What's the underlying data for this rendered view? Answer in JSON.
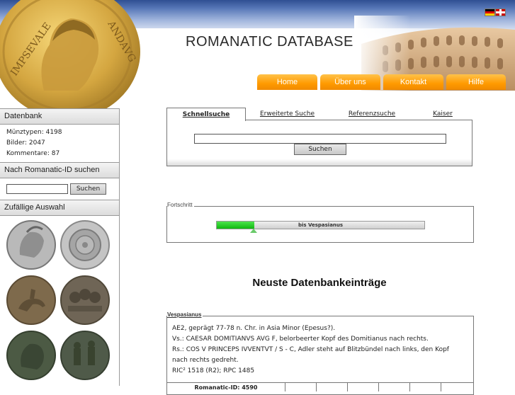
{
  "header": {
    "title": "ROMANATIC DATABASE",
    "nav": [
      "Home",
      "Über uns",
      "Kontakt",
      "Hilfe"
    ],
    "languages": [
      "Deutsch",
      "English"
    ]
  },
  "sidebar": {
    "datenbank": {
      "heading": "Datenbank",
      "stats": [
        "Münztypen: 4198",
        "Bilder: 2047",
        "Kommentare: 87"
      ]
    },
    "id_search": {
      "heading": "Nach Romanatic-ID suchen",
      "button": "Suchen"
    },
    "random": {
      "heading": "Zufällige Auswahl"
    }
  },
  "search": {
    "tabs": [
      "Schnellsuche",
      "Erweiterte Suche",
      "Referenzsuche",
      "Kaiser"
    ],
    "button": "Suchen"
  },
  "progress": {
    "legend": "Fortschritt",
    "label": "bis Vespasianus",
    "fraction": 0.18
  },
  "newest": {
    "title": "Neuste Datenbankeinträge",
    "entry": {
      "legend": "Vespasianus",
      "lines": [
        "AE2, geprägt 77-78 n. Chr. in Asia Minor (Epesus?).",
        "Vs.: CAESAR DOMITIANVS AVG F, belorbeerter Kopf des Domitianus nach rechts.",
        "Rs.: COS V PRINCEPS IVVENTVT / S - C, Adler steht auf Blitzbündel nach links, den Kopf nach rechts gedreht.",
        "RIC² 1518 (R2); RPC 1485"
      ],
      "footer_id": "Romanatic-ID: 4590"
    }
  },
  "colors": {
    "nav_orange": "#ff9a00",
    "progress_green": "#10b810",
    "sky_blue": "#2f4f92"
  }
}
